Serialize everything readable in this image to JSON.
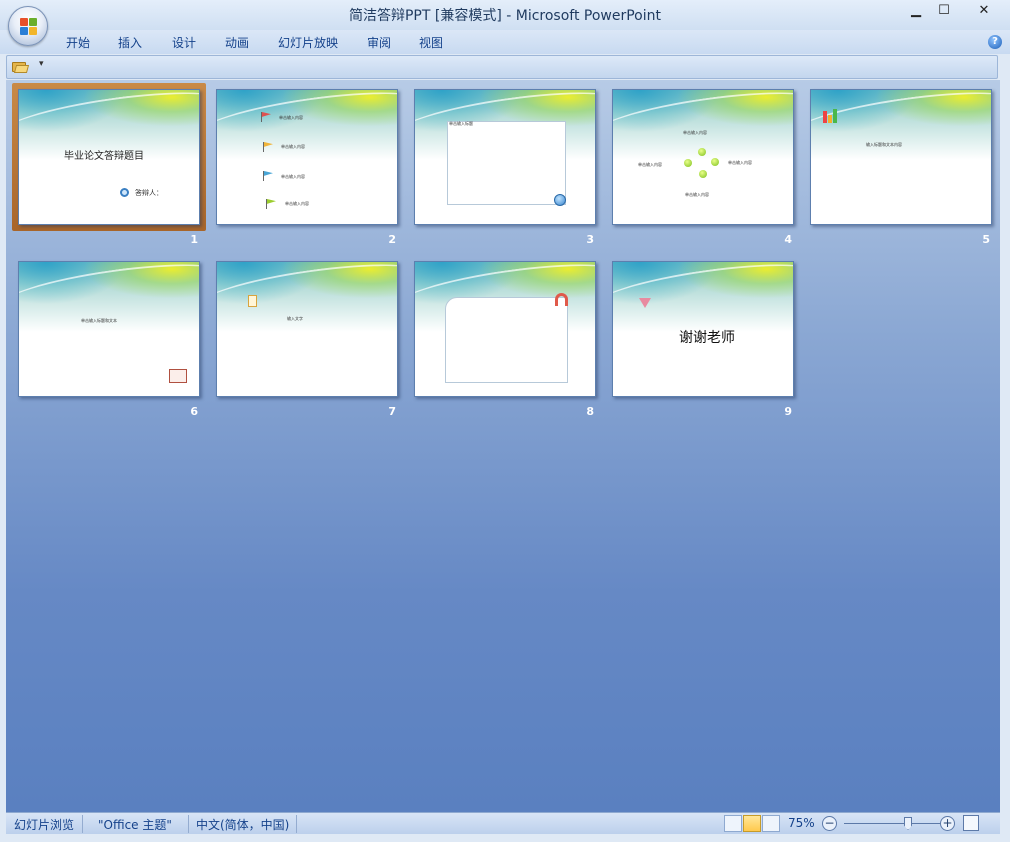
{
  "window": {
    "title": "简洁答辩PPT [兼容模式] - Microsoft PowerPoint",
    "minimize": "▁",
    "maximize": "☐",
    "close": "✕"
  },
  "ribbon": {
    "tabs": [
      "开始",
      "插入",
      "设计",
      "动画",
      "幻灯片放映",
      "审阅",
      "视图"
    ],
    "help": "?"
  },
  "qat": {
    "customize": "▾"
  },
  "slides": [
    {
      "number": "1",
      "selected": true,
      "title": "毕业论文答辩题目",
      "subtitle": "答辩人："
    },
    {
      "number": "2",
      "items": [
        "单击输入内容",
        "单击输入内容",
        "单击输入内容",
        "单击输入内容"
      ]
    },
    {
      "number": "3",
      "caption": "单击输入标题"
    },
    {
      "number": "4",
      "items": [
        "单击输入内容",
        "单击输入内容",
        "单击输入内容",
        "单击输入内容"
      ]
    },
    {
      "number": "5",
      "caption": "输入标题和文本内容"
    },
    {
      "number": "6",
      "caption": "单击输入标题和文本"
    },
    {
      "number": "7",
      "caption": "输入文字"
    },
    {
      "number": "8"
    },
    {
      "number": "9",
      "title": "谢谢老师"
    }
  ],
  "status": {
    "view_name": "幻灯片浏览",
    "theme": "\"Office 主题\"",
    "language": "中文(简体，中国)",
    "zoom": "75%",
    "zoom_out": "−",
    "zoom_in": "+"
  },
  "colors": {
    "accent": "#15428b",
    "selection": "#b8763a",
    "workspace_top": "#b7cbe6",
    "workspace_bottom": "#5a80c0"
  }
}
